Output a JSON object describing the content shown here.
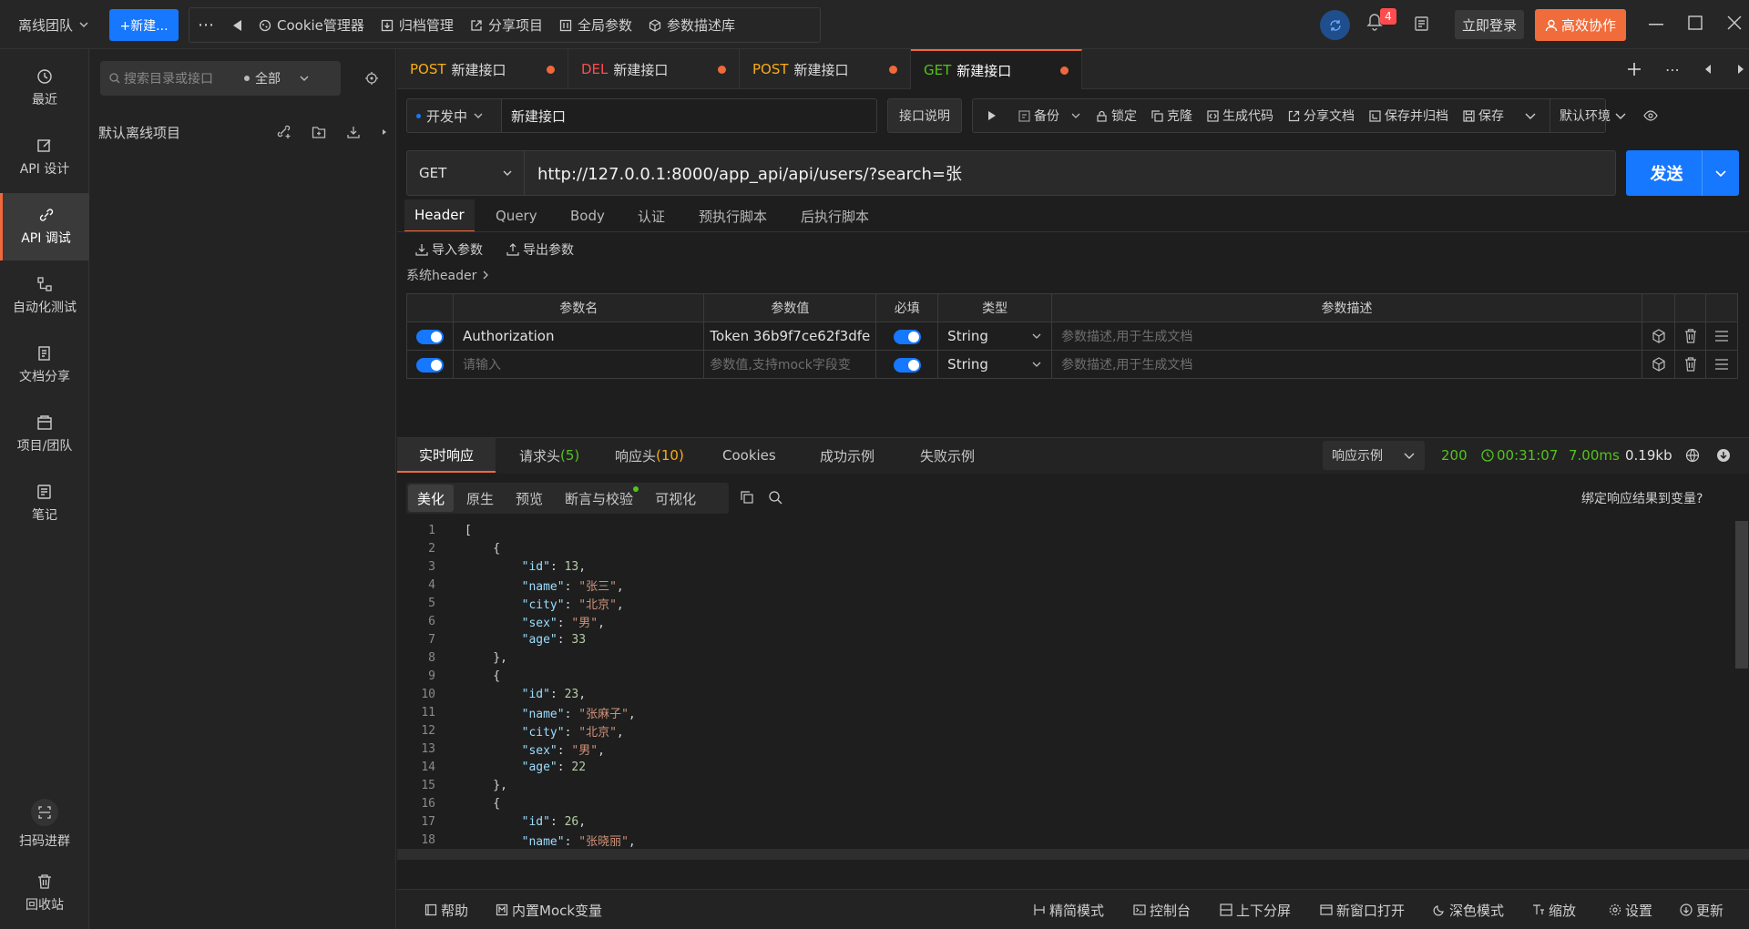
{
  "topbar": {
    "team": "离线团队",
    "new_label": "+新建...",
    "tools": [
      "Cookie管理器",
      "归档管理",
      "分享项目",
      "全局参数",
      "参数描述库"
    ],
    "badge_count": "4",
    "login_label": "立即登录",
    "collab_label": "高效协作"
  },
  "rail": {
    "items": [
      {
        "label": "最近",
        "icon": "clock-icon"
      },
      {
        "label": "API 设计",
        "icon": "edit-icon"
      },
      {
        "label": "API 调试",
        "icon": "link-icon"
      },
      {
        "label": "自动化测试",
        "icon": "flow-icon"
      },
      {
        "label": "文档分享",
        "icon": "doc-icon"
      },
      {
        "label": "项目/团队",
        "icon": "project-icon"
      },
      {
        "label": "笔记",
        "icon": "note-icon"
      }
    ],
    "scan_label": "扫码进群",
    "trash_label": "回收站"
  },
  "sidebar": {
    "search_placeholder": "搜索目录或接口",
    "filter": "全部",
    "project": "默认离线项目"
  },
  "tabs": [
    {
      "method": "POST",
      "name": "新建接口",
      "color": "#faad14"
    },
    {
      "method": "DEL",
      "name": "新建接口",
      "color": "#ff4d4f"
    },
    {
      "method": "POST",
      "name": "新建接口",
      "color": "#faad14"
    },
    {
      "method": "GET",
      "name": "新建接口",
      "color": "#52c41a"
    }
  ],
  "request": {
    "status": "开发中",
    "name": "新建接口",
    "explain_label": "接口说明",
    "actions": [
      "备份",
      "锁定",
      "克隆",
      "生成代码",
      "分享文档",
      "保存并归档",
      "保存"
    ],
    "env": "默认环境",
    "method": "GET",
    "url": "http://127.0.0.1:8000/app_api/api/users/?search=张",
    "send_label": "发送"
  },
  "sections": [
    "Header",
    "Query",
    "Body",
    "认证",
    "预执行脚本",
    "后执行脚本"
  ],
  "params": {
    "import_label": "导入参数",
    "export_label": "导出参数",
    "sys_header": "系统header",
    "columns": [
      "参数名",
      "参数值",
      "必填",
      "类型",
      "参数描述"
    ],
    "rows": [
      {
        "name": "Authorization",
        "value": "Token 36b9f7ce62f3dfe",
        "type": "String",
        "desc": "参数描述,用于生成文档"
      },
      {
        "name": "请输入",
        "value": "参数值,支持mock字段变",
        "type": "String",
        "desc": "参数描述,用于生成文档"
      }
    ]
  },
  "response": {
    "tabs": [
      "实时响应",
      "请求头",
      "响应头",
      "Cookies",
      "成功示例",
      "失败示例"
    ],
    "req_headers_count": "(5)",
    "resp_headers_count": "(10)",
    "example_label": "响应示例",
    "status": "200",
    "time": "00:31:07",
    "duration": "7.00ms",
    "size": "0.19kb",
    "view_tabs": [
      "美化",
      "原生",
      "预览",
      "断言与校验",
      "可视化"
    ],
    "bind_label": "绑定响应结果到变量?"
  },
  "code_lines": [
    {
      "n": "1",
      "html": "["
    },
    {
      "n": "2",
      "html": "    {"
    },
    {
      "n": "3",
      "key": "id",
      "val": "13",
      "type": "num",
      "comma": true
    },
    {
      "n": "4",
      "key": "name",
      "val": "张三",
      "type": "str",
      "comma": true
    },
    {
      "n": "5",
      "key": "city",
      "val": "北京",
      "type": "str",
      "comma": true
    },
    {
      "n": "6",
      "key": "sex",
      "val": "男",
      "type": "str",
      "comma": true
    },
    {
      "n": "7",
      "key": "age",
      "val": "33",
      "type": "num",
      "comma": false
    },
    {
      "n": "8",
      "html": "    },"
    },
    {
      "n": "9",
      "html": "    {"
    },
    {
      "n": "10",
      "key": "id",
      "val": "23",
      "type": "num",
      "comma": true
    },
    {
      "n": "11",
      "key": "name",
      "val": "张麻子",
      "type": "str",
      "comma": true
    },
    {
      "n": "12",
      "key": "city",
      "val": "北京",
      "type": "str",
      "comma": true
    },
    {
      "n": "13",
      "key": "sex",
      "val": "男",
      "type": "str",
      "comma": true
    },
    {
      "n": "14",
      "key": "age",
      "val": "22",
      "type": "num",
      "comma": false
    },
    {
      "n": "15",
      "html": "    },"
    },
    {
      "n": "16",
      "html": "    {"
    },
    {
      "n": "17",
      "key": "id",
      "val": "26",
      "type": "num",
      "comma": true
    },
    {
      "n": "18",
      "key": "name",
      "val": "张晓丽",
      "type": "str",
      "comma": true
    }
  ],
  "bottombar": [
    "帮助",
    "内置Mock变量",
    "精简模式",
    "控制台",
    "上下分屏",
    "新窗口打开",
    "深色模式",
    "缩放",
    "设置",
    "更新"
  ]
}
